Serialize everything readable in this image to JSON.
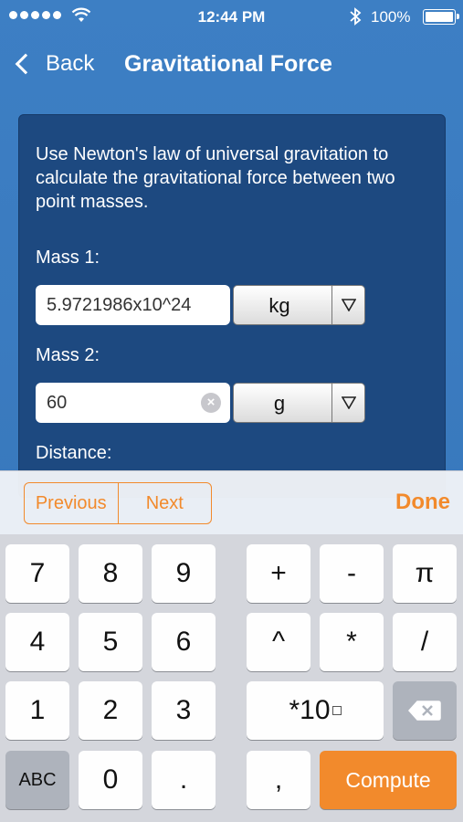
{
  "status": {
    "time": "12:44 PM",
    "battery": "100%"
  },
  "nav": {
    "back_label": "Back",
    "title": "Gravitational Force"
  },
  "form": {
    "description": "Use Newton's law of universal gravitation to calculate the gravitational force between two point masses.",
    "mass1": {
      "label": "Mass 1:",
      "value": "5.9721986x10^24",
      "unit": "kg"
    },
    "mass2": {
      "label": "Mass 2:",
      "value": "60",
      "unit": "g"
    },
    "distance": {
      "label": "Distance:"
    }
  },
  "accessory": {
    "previous": "Previous",
    "next": "Next",
    "done": "Done"
  },
  "keyboard": {
    "rows": [
      [
        "7",
        "8",
        "9",
        "+",
        "-",
        "π"
      ],
      [
        "4",
        "5",
        "6",
        "^",
        "*",
        "/"
      ],
      [
        "1",
        "2",
        "3"
      ],
      [
        "ABC",
        "0",
        ".",
        ","
      ]
    ],
    "exp_key": "*10",
    "compute": "Compute"
  },
  "colors": {
    "accent": "#f28a2c",
    "nav_background": "#3d7fc4",
    "card_background": "#1d4980"
  }
}
